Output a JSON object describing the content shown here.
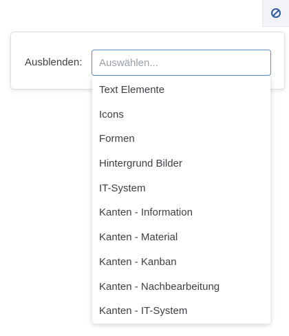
{
  "toolbar": {
    "corner_icon": "ban-icon",
    "icon_color": "#2d5a9e"
  },
  "filter": {
    "label": "Ausblenden:",
    "placeholder": "Auswählen...",
    "options": [
      "Text Elemente",
      "Icons",
      "Formen",
      "Hintergrund Bilder",
      "IT-System",
      "Kanten - Information",
      "Kanten - Material",
      "Kanten - Kanban",
      "Kanten - Nachbearbeitung",
      "Kanten - IT-System"
    ]
  },
  "colors": {
    "focus_border": "#5b8fc4",
    "text": "#3b3f44",
    "placeholder": "#9aa0a6"
  }
}
